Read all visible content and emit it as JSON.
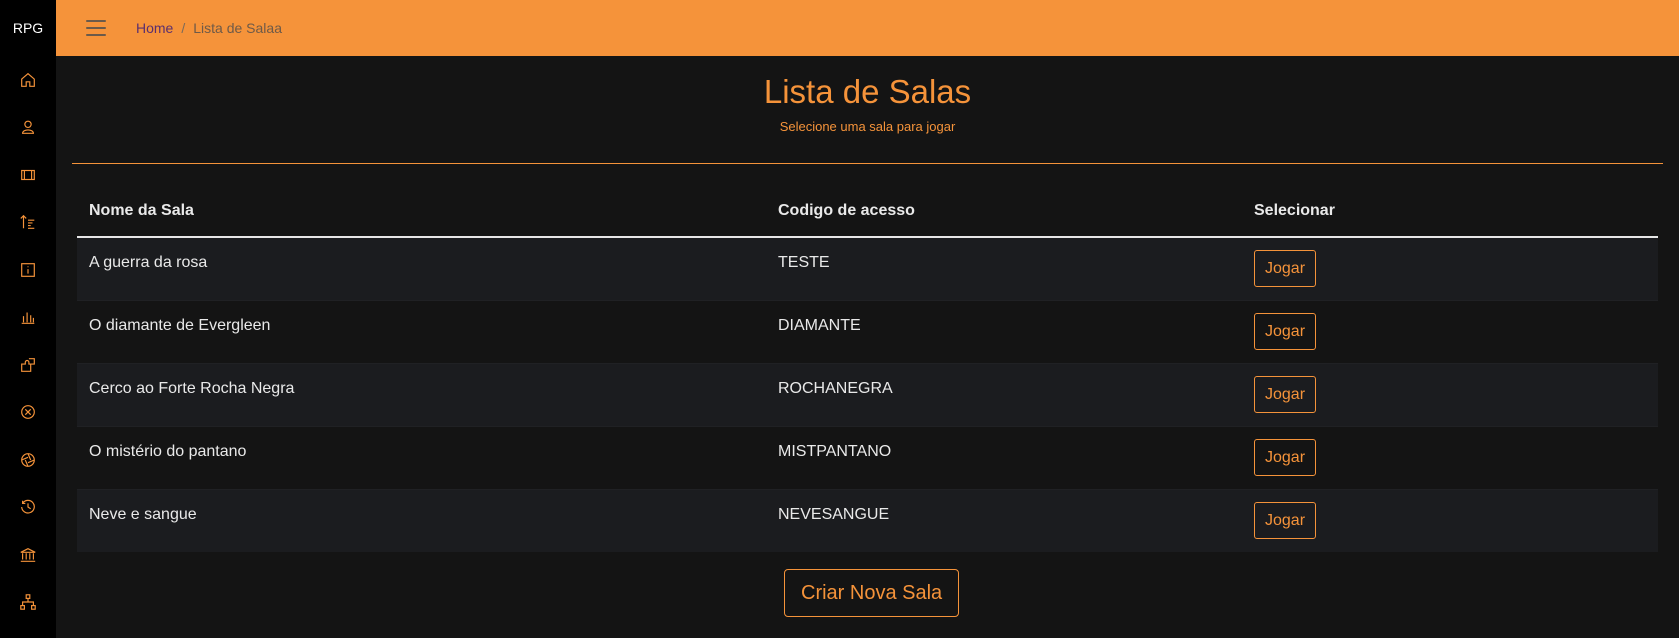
{
  "sidebar": {
    "brand": "RPG",
    "items": [
      {
        "icon": "home-icon"
      },
      {
        "icon": "user-icon"
      },
      {
        "icon": "film-icon"
      },
      {
        "icon": "sort-icon"
      },
      {
        "icon": "info-icon"
      },
      {
        "icon": "bar-chart-icon"
      },
      {
        "icon": "puzzle-icon"
      },
      {
        "icon": "close-circle-icon"
      },
      {
        "icon": "aperture-icon"
      },
      {
        "icon": "history-icon"
      },
      {
        "icon": "bank-icon"
      },
      {
        "icon": "sitemap-icon"
      }
    ]
  },
  "header": {
    "breadcrumb_home": "Home",
    "breadcrumb_separator": "/",
    "breadcrumb_current": "Lista de Salaa"
  },
  "page": {
    "title": "Lista de Salas",
    "subtitle": "Selecione uma sala para jogar"
  },
  "table": {
    "columns": [
      "Nome da Sala",
      "Codigo de acesso",
      "Selecionar"
    ],
    "rows": [
      {
        "name": "A guerra da rosa",
        "code": "TESTE",
        "action": "Jogar"
      },
      {
        "name": "O diamante de Evergleen",
        "code": "DIAMANTE",
        "action": "Jogar"
      },
      {
        "name": "Cerco ao Forte Rocha Negra",
        "code": "ROCHANEGRA",
        "action": "Jogar"
      },
      {
        "name": "O mistério do pantano",
        "code": "MISTPANTANO",
        "action": "Jogar"
      },
      {
        "name": "Neve e sangue",
        "code": "NEVESANGUE",
        "action": "Jogar"
      }
    ]
  },
  "actions": {
    "create_room": "Criar Nova Sala"
  },
  "colors": {
    "accent": "#f5933a",
    "background": "#141414",
    "sidebar": "#000000"
  }
}
